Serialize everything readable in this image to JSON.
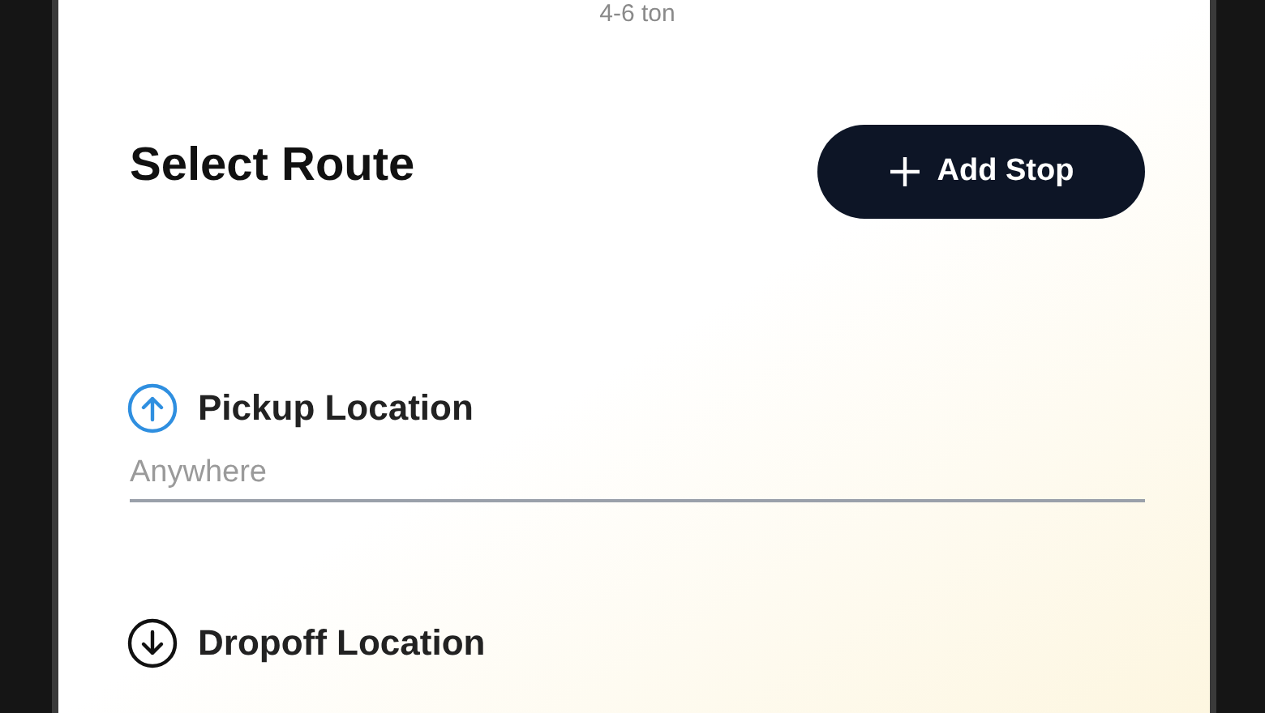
{
  "vehicle_caption": "4-6 ton",
  "section_title": "Select Route",
  "add_stop_button": {
    "label": "Add Stop"
  },
  "locations": [
    {
      "kind": "pickup",
      "label": "Pickup Location",
      "placeholder": "Anywhere"
    },
    {
      "kind": "dropoff",
      "label": "Dropoff Location"
    }
  ]
}
